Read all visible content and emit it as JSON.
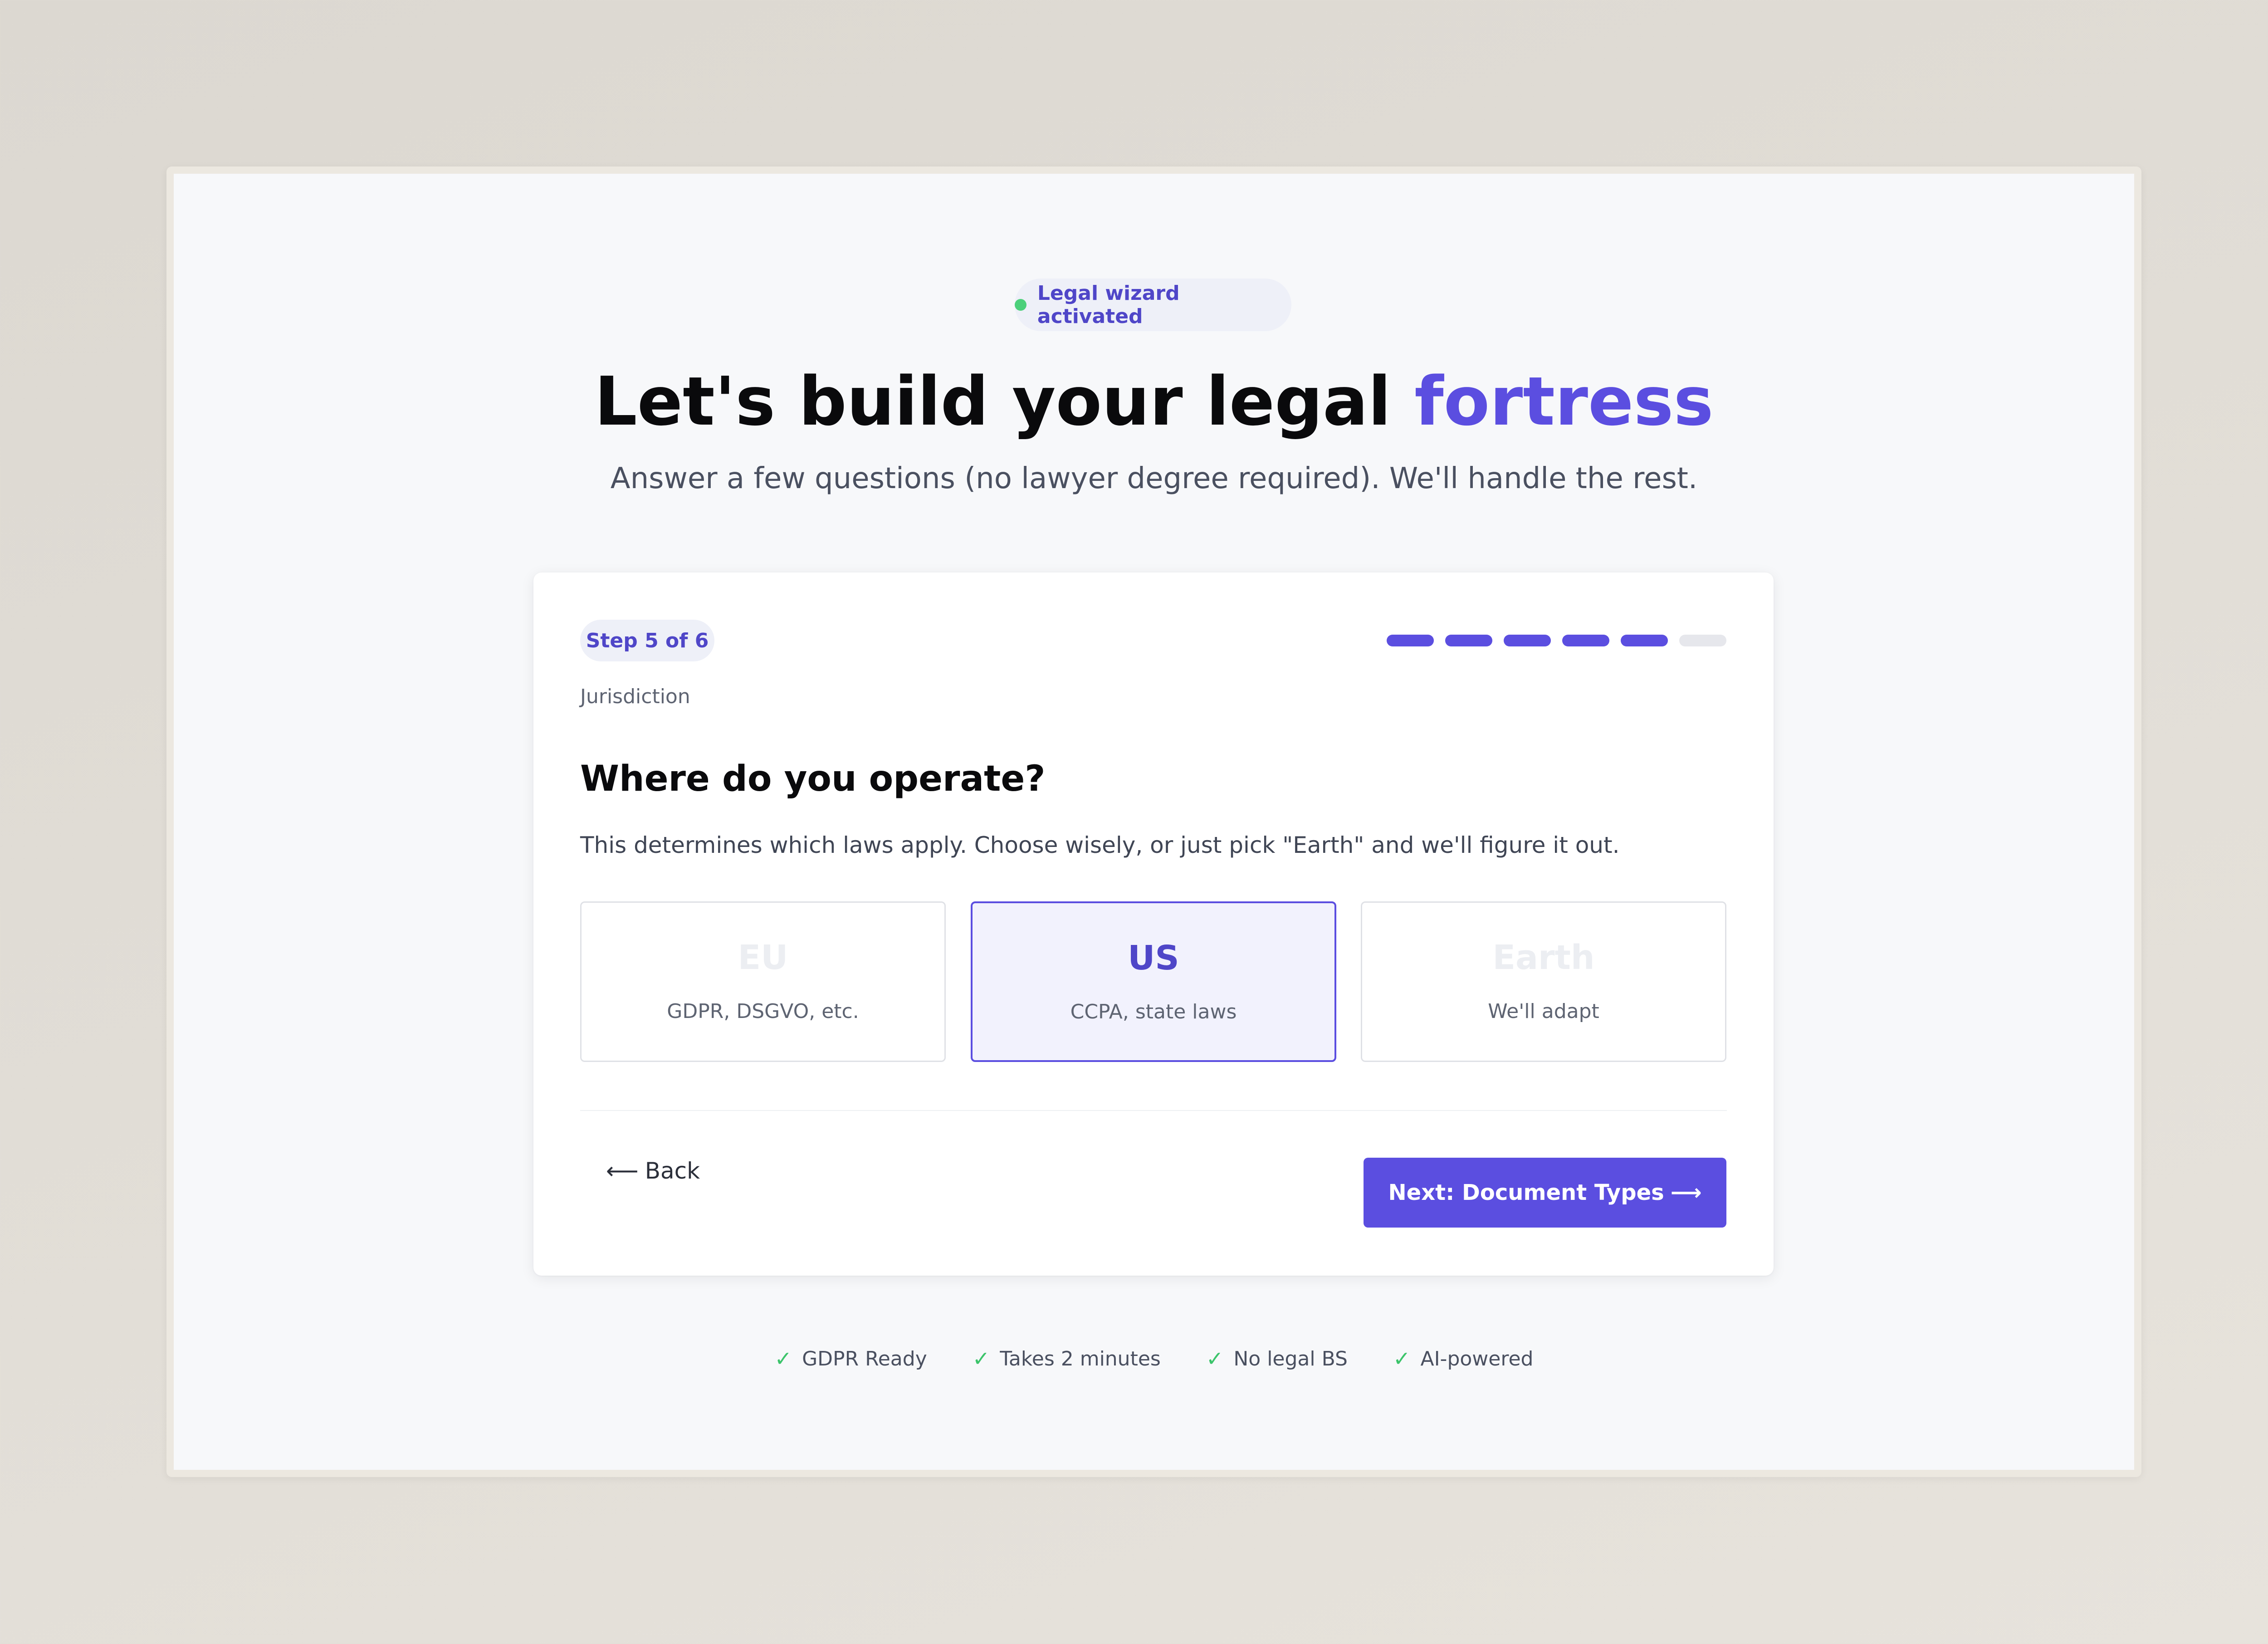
{
  "badge": {
    "text": "Legal wizard activated",
    "dot_color": "#4cd07a"
  },
  "hero": {
    "headline_prefix": "Let's build your legal ",
    "headline_accent": "fortress",
    "subtitle": "Answer a few questions (no lawyer degree required). We'll handle the rest."
  },
  "wizard": {
    "step_label": "Step 5 of 6",
    "current_step": 5,
    "total_steps": 6,
    "section": "Jurisdiction",
    "question": "Where do you operate?",
    "description": "This determines which laws apply. Choose wisely, or just pick \"Earth\" and we'll figure it out.",
    "options": [
      {
        "title": "EU",
        "subtitle": "GDPR, DSGVO, etc.",
        "selected": false
      },
      {
        "title": "US",
        "subtitle": "CCPA, state laws",
        "selected": true
      },
      {
        "title": "Earth",
        "subtitle": "We'll adapt",
        "selected": false
      }
    ],
    "back_label": "Back",
    "back_arrow": "⟵",
    "next_label": "Next: Document Types",
    "next_arrow": "⟶"
  },
  "features": [
    {
      "icon": "check-icon",
      "glyph": "✓",
      "label": "GDPR Ready"
    },
    {
      "icon": "check-icon",
      "glyph": "✓",
      "label": "Takes 2 minutes"
    },
    {
      "icon": "check-icon",
      "glyph": "✓",
      "label": "No legal BS"
    },
    {
      "icon": "check-icon",
      "glyph": "✓",
      "label": "AI-powered"
    }
  ],
  "colors": {
    "accent": "#5b4ee0",
    "highlight": "#f5d543",
    "success": "#3bc46a"
  }
}
